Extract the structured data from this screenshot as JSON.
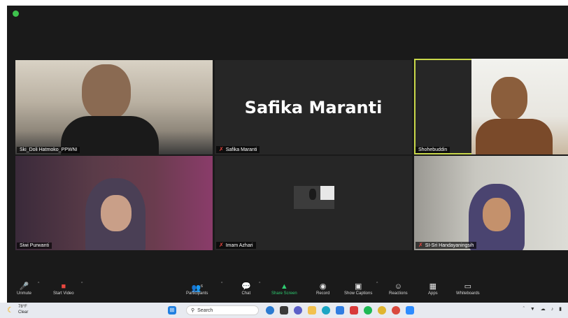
{
  "participants": [
    {
      "name": "Ski_Doli Hatmoko_PPWNI",
      "muted": false,
      "active": false,
      "video": true
    },
    {
      "name": "Safika Maranti",
      "muted": true,
      "active": false,
      "video": false,
      "display_name": "Safika Maranti"
    },
    {
      "name": "Shohebuddin",
      "muted": false,
      "active": true,
      "video": true
    },
    {
      "name": "Siwi Purwanti",
      "muted": false,
      "active": false,
      "video": true
    },
    {
      "name": "Imam Azhari",
      "muted": true,
      "active": false,
      "video": true
    },
    {
      "name": "SI-Sri Handayaningsih",
      "muted": true,
      "active": false,
      "video": true
    }
  ],
  "toolbar": {
    "unmute": "Unmute",
    "start_video": "Start Video",
    "participants": "Participants",
    "participants_count": "6",
    "chat": "Chat",
    "share_screen": "Share Screen",
    "record": "Record",
    "show_captions": "Show Captions",
    "reactions": "Reactions",
    "apps": "Apps",
    "whiteboards": "Whiteboards"
  },
  "taskbar": {
    "temperature": "78°F",
    "weather": "Clear",
    "search_placeholder": "Search"
  },
  "colors": {
    "active_speaker": "#c9d84a",
    "muted": "#e8473f",
    "share_screen": "#2ecc71"
  }
}
